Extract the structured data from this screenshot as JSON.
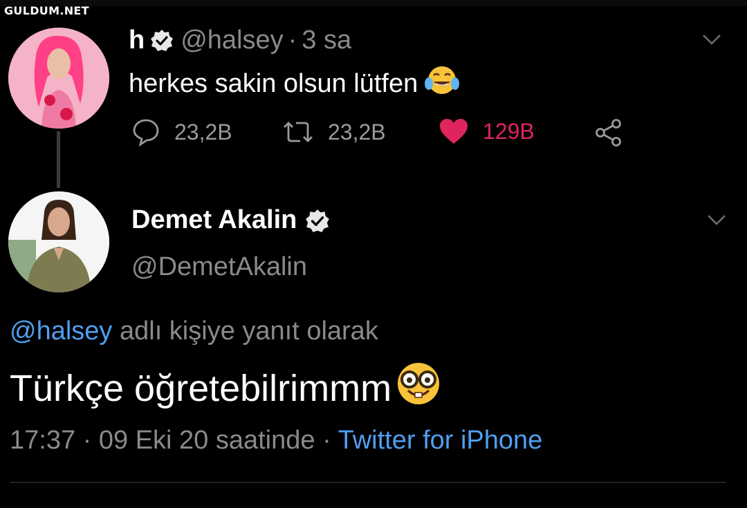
{
  "watermark": "GULDUM.NET",
  "parent_tweet": {
    "name": "h",
    "handle": "@halsey",
    "separator": "·",
    "time": "3 sa",
    "text": "herkes sakin olsun lütfen",
    "emoji": "face-with-tears-of-joy",
    "actions": {
      "reply_count": "23,2B",
      "retweet_count": "23,2B",
      "like_count": "129B"
    }
  },
  "reply_tweet": {
    "name": "Demet Akalin",
    "handle": "@DemetAkalin",
    "reply_to_mention": "@halsey",
    "reply_to_text": " adlı kişiye yanıt olarak",
    "text": "Türkçe öğretebilrimmm",
    "emoji": "nerd-face",
    "timestamp": "17:37 · 09 Eki 20 saatinde",
    "meta_separator": " · ",
    "source": "Twitter for iPhone"
  },
  "colors": {
    "background": "#000000",
    "link": "#4f9ff0",
    "like": "#e0245e",
    "muted": "#8a8a8a"
  }
}
